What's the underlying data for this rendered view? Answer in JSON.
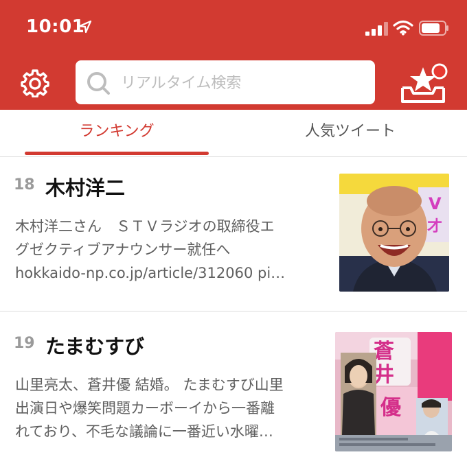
{
  "status_bar": {
    "time": "10:01"
  },
  "search": {
    "placeholder": "リアルタイム検索",
    "value": ""
  },
  "tabs": [
    {
      "label": "ランキング",
      "active": true
    },
    {
      "label": "人気ツイート",
      "active": false
    }
  ],
  "items": [
    {
      "rank": "18",
      "title": "木村洋二",
      "desc_lines": [
        "木村洋二さん　ＳＴＶラジオの取締役エ",
        "グゼクティブアナウンサー就任へ",
        "hokkaido-np.co.jp/article/312060 pi…"
      ]
    },
    {
      "rank": "19",
      "title": "たまむすび",
      "desc_lines": [
        "山里亮太、蒼井優 結婚。 たまむすび山里",
        "出演日や爆笑問題カーボーイから一番離",
        "れており、不毛な議論に一番近い水曜…"
      ]
    }
  ],
  "colors": {
    "brand_red": "#d23a31",
    "text_gray": "#5f5f5f",
    "rank_gray": "#9a9a9a"
  }
}
